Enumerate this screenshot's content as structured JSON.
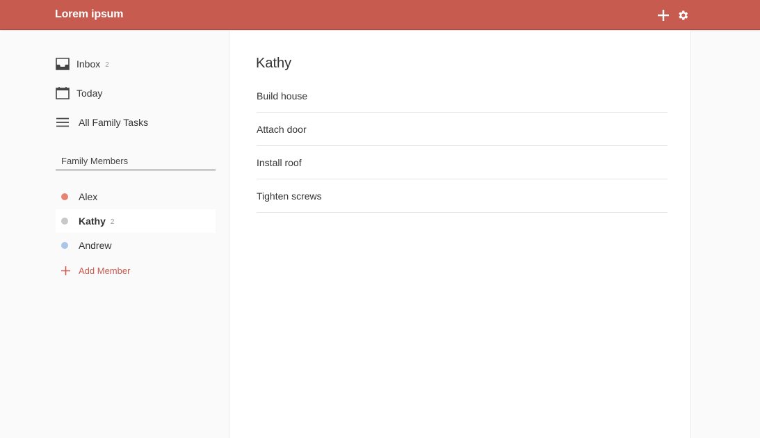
{
  "app": {
    "title": "Lorem ipsum",
    "accent": "#c85b50"
  },
  "header": {
    "add_icon": "plus-icon",
    "settings_icon": "gear-icon"
  },
  "sidebar": {
    "nav": [
      {
        "label": "Inbox",
        "count": "2",
        "icon": "inbox-icon"
      },
      {
        "label": "Today",
        "count": "",
        "icon": "calendar-icon"
      },
      {
        "label": "All Family Tasks",
        "count": "",
        "icon": "list-icon"
      }
    ],
    "section_title": "Family Members",
    "members": [
      {
        "name": "Alex",
        "count": "",
        "color": "#e8836f"
      },
      {
        "name": "Kathy",
        "count": "2",
        "color": "#c8c8c8"
      },
      {
        "name": "Andrew",
        "count": "",
        "color": "#a9c6e8"
      }
    ],
    "add_member_label": "Add Member"
  },
  "main": {
    "title": "Kathy",
    "tasks": [
      "Build house",
      "Attach door",
      "Install roof",
      "Tighten screws"
    ]
  }
}
